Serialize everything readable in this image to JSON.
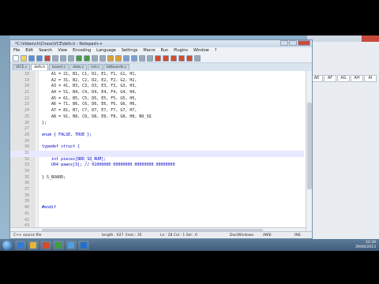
{
  "window": {
    "title": "*C:\\Video\\ch\\Chess\\VCE\\defs.h - Notepad++",
    "menu": [
      "File",
      "Edit",
      "Search",
      "View",
      "Encoding",
      "Language",
      "Settings",
      "Macro",
      "Run",
      "Plugins",
      "Window",
      "?"
    ],
    "tabs": [
      {
        "label": "VICE.c",
        "active": false
      },
      {
        "label": "defs.h",
        "active": true
      },
      {
        "label": "board.c",
        "active": false
      },
      {
        "label": "data.c",
        "active": false
      },
      {
        "label": "init.c",
        "active": false
      },
      {
        "label": "bitboards.c",
        "active": false
      }
    ]
  },
  "editor": {
    "lines": [
      {
        "n": "18",
        "text": "    A1 = 21, B1, C1, D1, E1, F1, G1, H1,"
      },
      {
        "n": "19",
        "text": "    A2 = 31, B2, C2, D2, E2, F2, G2, H2,"
      },
      {
        "n": "20",
        "text": "    A3 = 41, B3, C3, D3, E3, F3, G3, H3,"
      },
      {
        "n": "21",
        "text": "    A4 = 51, B4, C4, D4, E4, F4, G4, H4,"
      },
      {
        "n": "22",
        "text": "    A5 = 61, B5, C5, D5, E5, F5, G5, H5,"
      },
      {
        "n": "23",
        "text": "    A6 = 71, B6, C6, D6, E6, F6, G6, H6,"
      },
      {
        "n": "24",
        "text": "    A7 = 81, B7, C7, D7, E7, F7, G7, H7,"
      },
      {
        "n": "25",
        "text": "    A8 = 91, B8, C8, D8, E8, F8, G8, H8, NO_SQ"
      },
      {
        "n": "26",
        "text": "};"
      },
      {
        "n": "27",
        "text": ""
      },
      {
        "n": "28",
        "text": "enum { FALSE, TRUE };"
      },
      {
        "n": "29",
        "text": ""
      },
      {
        "n": "30",
        "text": "typedef struct {"
      },
      {
        "n": "31",
        "text": ""
      },
      {
        "n": "32",
        "text": "    int pieces[BRD_SQ_NUM];"
      },
      {
        "n": "33",
        "text": "    U64 pawns[3]; // 01000000 00000000 00000000 00000000"
      },
      {
        "n": "34",
        "text": ""
      },
      {
        "n": "35",
        "text": "} S_BOARD;"
      },
      {
        "n": "36",
        "text": ""
      },
      {
        "n": "37",
        "text": ""
      },
      {
        "n": "38",
        "text": ""
      },
      {
        "n": "39",
        "text": ""
      },
      {
        "n": "40",
        "text": "#endif"
      },
      {
        "n": "41",
        "text": ""
      },
      {
        "n": "42",
        "text": ""
      },
      {
        "n": "43",
        "text": ""
      }
    ],
    "current_line_index": 13
  },
  "statusbar": {
    "file_type": "C++ source file",
    "length": "length : 627",
    "lines": "lines : 35",
    "position": "Ln : 28    Col : 1    Sel : 0",
    "eol": "Dos\\Windows",
    "encoding": "ANSI",
    "mode": "INS"
  },
  "background_app": {
    "cells": [
      "AE",
      "AF",
      "AG",
      "AH",
      "AI"
    ]
  },
  "taskbar": {
    "time": "22:34",
    "date": "29/06/2013",
    "app_icons": [
      "#2f7bd8",
      "#e8b43a",
      "#d84a2a",
      "#3f9e3f",
      "#4fa0e0",
      "#1f6fcf"
    ]
  },
  "colors": {
    "keyword": "#0000c8",
    "current_line": "#e8e8ff",
    "desktop": "#8fb0c8"
  }
}
